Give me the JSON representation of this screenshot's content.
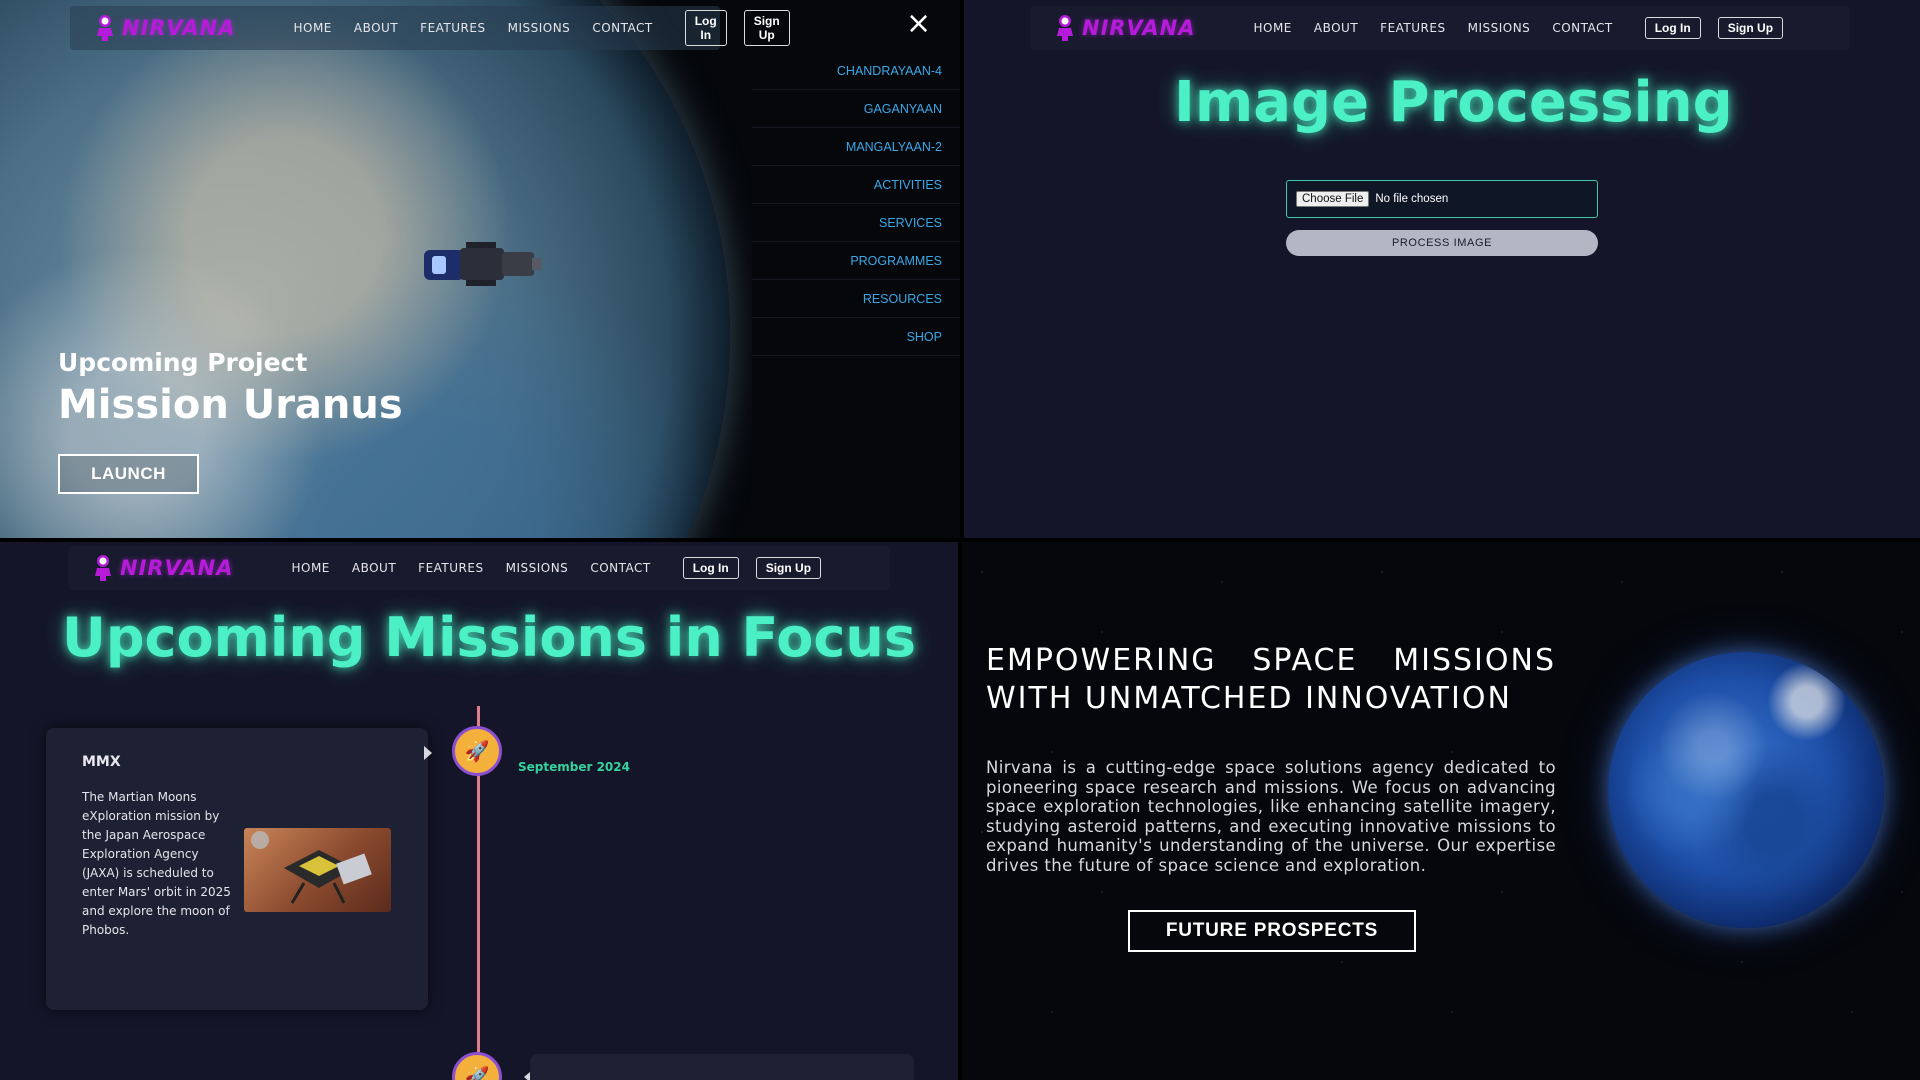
{
  "brand": "NIRVANA",
  "nav": {
    "links": [
      "HOME",
      "ABOUT",
      "FEATURES",
      "MISSIONS",
      "CONTACT"
    ],
    "login": "Log In",
    "signup": "Sign Up"
  },
  "hero": {
    "close_icon": "×",
    "menu_items": [
      "CHANDRAYAAN-4",
      "GAGANYAAN",
      "MANGALYAAN-2",
      "ACTIVITIES",
      "SERVICES",
      "PROGRAMMES",
      "RESOURCES",
      "SHOP"
    ],
    "subtitle": "Upcoming Project",
    "title": "Mission Uranus",
    "launch": "LAUNCH"
  },
  "image_processing": {
    "title": "Image Processing",
    "choose_file": "Choose File",
    "file_status": "No file chosen",
    "process": "PROCESS IMAGE"
  },
  "missions": {
    "title": "Upcoming Missions in Focus",
    "date": "September 2024",
    "card_title": "MMX",
    "card_text": "The Martian Moons eXploration mission by the Japan Aerospace Exploration Agency (JAXA) is scheduled to enter Mars' orbit in 2025 and explore the moon of Phobos.",
    "node_icon": "🚀"
  },
  "about": {
    "title": "EMPOWERING SPACE MISSIONS WITH UNMATCHED INNOVATION",
    "text": "Nirvana is a cutting-edge space solutions agency dedicated to pioneering space research and missions. We focus on advancing space exploration technologies, like enhancing satellite imagery, studying asteroid patterns, and executing innovative missions to expand humanity's understanding of the universe. Our expertise drives the future of space science and exploration.",
    "button": "FUTURE PROSPECTS"
  },
  "colors": {
    "brand": "#b51bd8",
    "accent": "#4bf0c4",
    "menu_link": "#3aa8e8",
    "timeline": "#e07d8d",
    "node": "#f3b13c"
  },
  "icons": {
    "logo": "astronaut-logo-icon",
    "close": "close-icon",
    "rocket": "rocket-icon"
  }
}
